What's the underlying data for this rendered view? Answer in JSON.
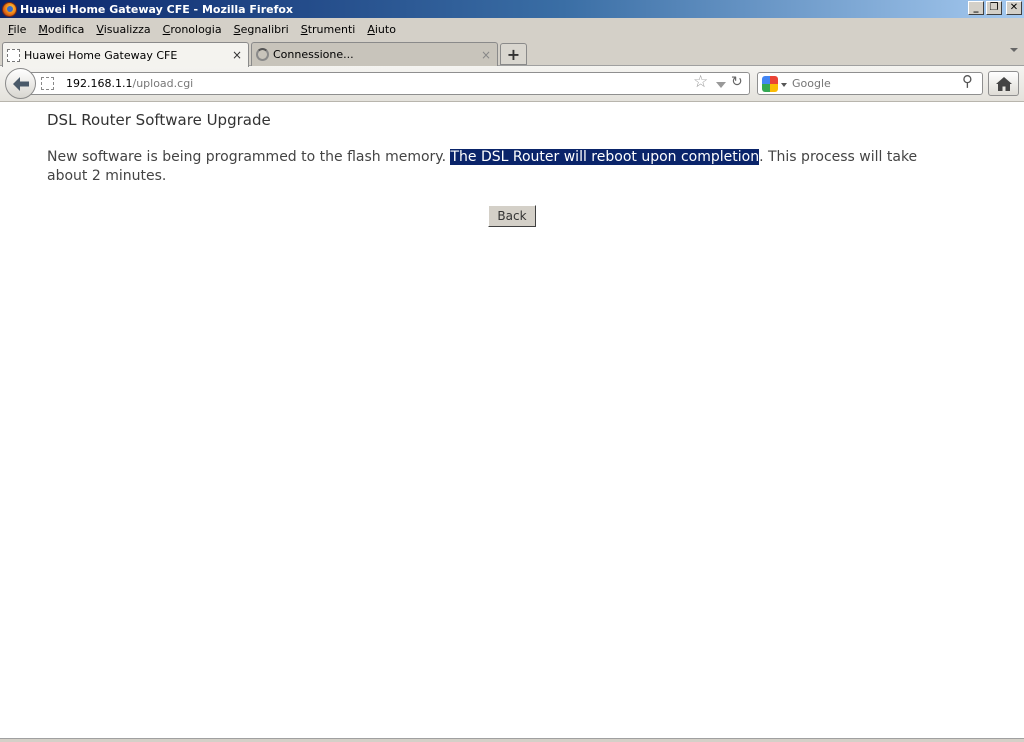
{
  "window": {
    "title": "Huawei Home Gateway CFE - Mozilla Firefox",
    "buttons": {
      "minimize": "_",
      "restore": "❐",
      "close": "✕"
    }
  },
  "menubar": {
    "items": [
      {
        "accel": "F",
        "rest": "ile"
      },
      {
        "accel": "M",
        "rest": "odifica"
      },
      {
        "accel": "V",
        "rest": "isualizza"
      },
      {
        "accel": "C",
        "rest": "ronologia"
      },
      {
        "accel": "S",
        "rest": "egnalibri"
      },
      {
        "accel": "S",
        "rest": "trumenti"
      },
      {
        "accel": "A",
        "rest": "iuto"
      }
    ]
  },
  "tabs": [
    {
      "label": "Huawei Home Gateway CFE",
      "active": true,
      "close": "×"
    },
    {
      "label": "Connessione...",
      "active": false,
      "close": "×"
    }
  ],
  "new_tab": "+",
  "navbar": {
    "url_host": "192.168.1.1",
    "url_path": "/upload.cgi",
    "search_placeholder": "Google"
  },
  "page": {
    "heading": "DSL Router Software Upgrade",
    "message_before": "New software is being programmed to the flash memory. ",
    "message_selected": "The DSL Router will reboot upon completion",
    "message_after": ". This process will take about 2 minutes.",
    "back_button": "Back"
  },
  "colors": {
    "selection_bg": "#0a246a",
    "titlebar_start": "#0a246a",
    "chrome_gray": "#d4d0c8"
  },
  "icons": {
    "app": "firefox-logo-icon",
    "back": "back-arrow-icon",
    "star": "bookmark-star-icon",
    "reload": "reload-icon",
    "search": "magnifier-icon",
    "home": "home-icon"
  }
}
